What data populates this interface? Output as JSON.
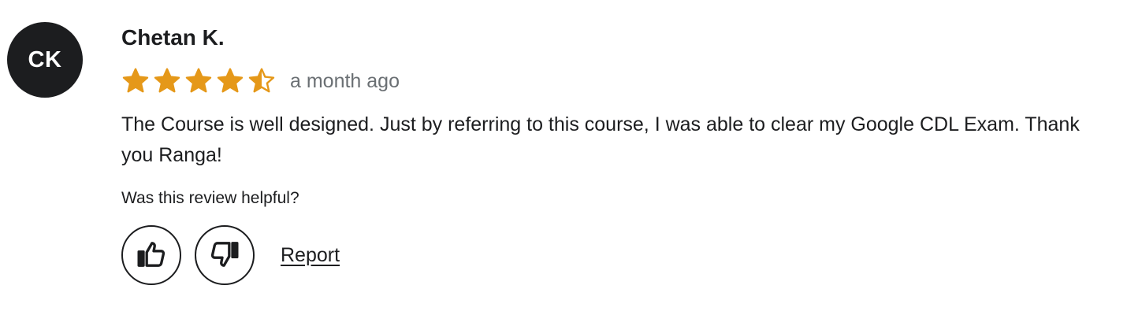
{
  "review": {
    "avatar_initials": "CK",
    "reviewer_name": "Chetan K.",
    "rating": 4.5,
    "rating_max": 5,
    "time_ago": "a month ago",
    "text": "The Course is well designed. Just by referring to this course, I was able to clear my Google CDL Exam. Thank you Ranga!",
    "helpful_prompt": "Was this review helpful?",
    "report_label": "Report",
    "thumbs_up_icon": "thumbs-up-icon",
    "thumbs_down_icon": "thumbs-down-icon"
  },
  "colors": {
    "star": "#e59819",
    "avatar_bg": "#1c1d1f",
    "text": "#1c1d1f",
    "muted": "#6a6f73"
  }
}
